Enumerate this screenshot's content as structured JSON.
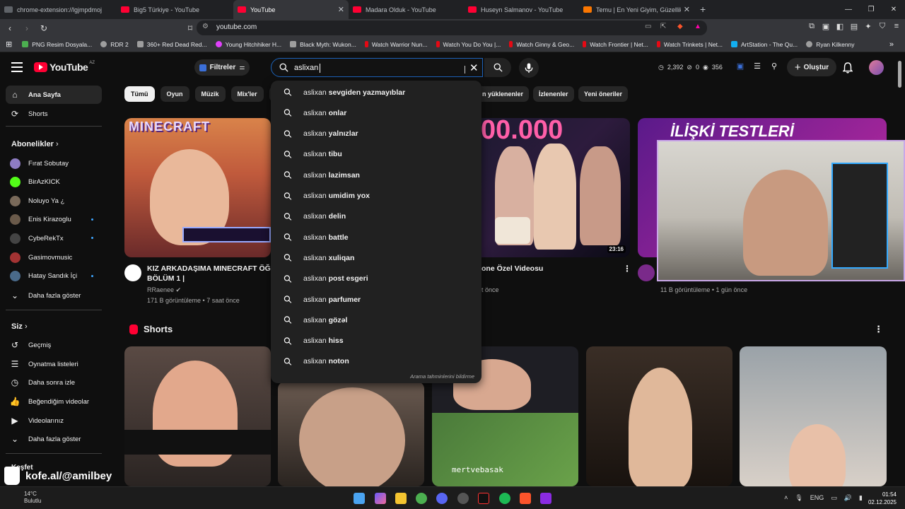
{
  "browser": {
    "tabs": [
      {
        "title": "chrome-extension://lgjmpdmojkpoc",
        "color": "#5f6368"
      },
      {
        "title": "Big5 Türkiye - YouTube",
        "color": "#ff0033"
      },
      {
        "title": "YouTube",
        "color": "#ff0033"
      },
      {
        "title": "Madara Olduk - YouTube",
        "color": "#ff0033"
      },
      {
        "title": "Huseyn Salmanov - YouTube",
        "color": "#ff0033"
      },
      {
        "title": "Temu | En Yeni Giyim, Güzellik, Ev, To",
        "color": "#fb7701"
      }
    ],
    "url": "youtube.com",
    "bookmarks": [
      {
        "label": "PNG Resim Dosyala...",
        "color": "#4caf50"
      },
      {
        "label": "RDR 2",
        "color": "#9e9e9e"
      },
      {
        "label": "360+ Red Dead Red...",
        "color": "#9e9e9e"
      },
      {
        "label": "Young Hitchhiker H...",
        "color": "#e040fb"
      },
      {
        "label": "Black Myth: Wukon...",
        "color": "#9e9e9e"
      },
      {
        "label": "Watch Warrior Nun...",
        "color": "#e50914"
      },
      {
        "label": "Watch You Do You |...",
        "color": "#e50914"
      },
      {
        "label": "Watch Ginny & Geo...",
        "color": "#e50914"
      },
      {
        "label": "Watch Frontier | Net...",
        "color": "#e50914"
      },
      {
        "label": "Watch Trinkets | Net...",
        "color": "#e50914"
      },
      {
        "label": "ArtStation - The Qu...",
        "color": "#13aff0"
      },
      {
        "label": "Ryan Kilkenny",
        "color": "#9e9e9e"
      }
    ]
  },
  "yt": {
    "logo": "YouTube",
    "country": "AZ",
    "filters": "Filtreler",
    "search_value": "aslixan",
    "stats": {
      "a": "2,392",
      "b": "0",
      "c": "356"
    },
    "create": "Oluştur"
  },
  "sidebar": {
    "home": "Ana Sayfa",
    "shorts": "Shorts",
    "subs_title": "Abonelikler",
    "subs": [
      {
        "name": "Fırat Sobutay",
        "color": "#8e7cc3",
        "dot": false
      },
      {
        "name": "BirAzKICK",
        "color": "#53fc18",
        "dot": false
      },
      {
        "name": "Noluyo Ya ¿",
        "color": "#7a6a5a",
        "dot": false
      },
      {
        "name": "Enis Kirazoglu",
        "color": "#6a5a4a",
        "dot": true
      },
      {
        "name": "CybeRekTx",
        "color": "#444444",
        "dot": true
      },
      {
        "name": "Gasimovmusic",
        "color": "#a33333",
        "dot": false
      },
      {
        "name": "Hatay Sandık İçi",
        "color": "#4a6a8a",
        "dot": true
      }
    ],
    "more": "Daha fazla göster",
    "you_title": "Siz",
    "you": [
      "Geçmiş",
      "Oynatma listeleri",
      "Daha sonra izle",
      "Beğendiğim videolar",
      "Videolarınız",
      "Daha fazla göster"
    ],
    "explore": "Keşfet"
  },
  "chips": [
    "Tümü",
    "Oyun",
    "Müzik",
    "Mix'ler"
  ],
  "chips_right": [
    "n yüklenenler",
    "İzlenenler",
    "Yeni öneriler"
  ],
  "suggestions": [
    {
      "prefix": "aslixan",
      "rest": " sevgiden yazmayıblar"
    },
    {
      "prefix": "aslixan",
      "rest": " onlar"
    },
    {
      "prefix": "aslixan",
      "rest": " yalnızlar"
    },
    {
      "prefix": "aslixan",
      "rest": " tibu"
    },
    {
      "prefix": "aslixan",
      "rest": " lazimsan"
    },
    {
      "prefix": "aslixan",
      "rest": " umidim yox"
    },
    {
      "prefix": "aslixan",
      "rest": " delin"
    },
    {
      "prefix": "aslixan",
      "rest": " battle"
    },
    {
      "prefix": "aslixan",
      "rest": " xuliqan"
    },
    {
      "prefix": "aslixan",
      "rest": " post esgeri"
    },
    {
      "prefix": "aslixan",
      "rest": " parfumer"
    },
    {
      "prefix": "aslixan",
      "rest": " gözəl"
    },
    {
      "prefix": "aslixan",
      "rest": " hiss"
    },
    {
      "prefix": "aslixan",
      "rest": " noton"
    }
  ],
  "report": "Arama tahminlerini bildirme",
  "videos": [
    {
      "title1": "KIZ ARKADAŞIMA MINECRAFT ÖĞRE",
      "title2": "BÖLÜM 1 |",
      "channel": "RRaenee",
      "meta": "171 B görüntüleme • 7 saat önce",
      "thumb_text": "MINECRAFT"
    },
    {
      "title1": "one Özel Videosu",
      "meta_partial": "t önce",
      "duration": "23:16",
      "thumb_text": "00.000"
    },
    {
      "meta": "11 B görüntüleme • 1 gün önce",
      "thumb_text": "İLİŞKİ TESTLERİ"
    }
  ],
  "shorts_title": "Shorts",
  "shorts_watermark": "mertvebasak",
  "overlay": {
    "kofe": "kofe.al/@amilbey"
  },
  "taskbar": {
    "temp": "14°C",
    "weather": "Bulutlu",
    "lang": "ENG",
    "time": "01:54",
    "date": "02.12.2025"
  }
}
